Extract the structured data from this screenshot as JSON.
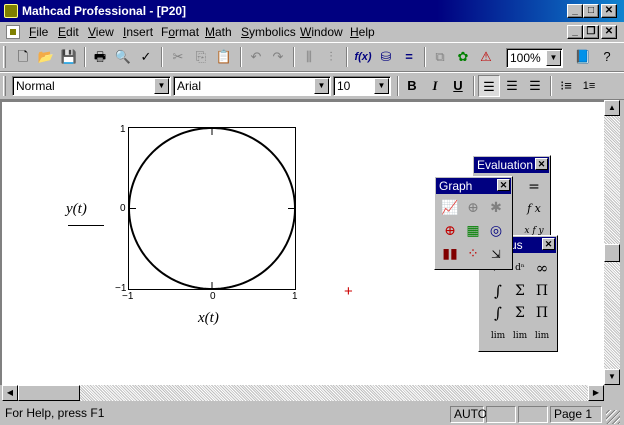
{
  "window": {
    "title": "Mathcad Professional - [P20]",
    "controls": {
      "minimize": "_",
      "maximize": "□",
      "close": "✕"
    }
  },
  "doc_controls": {
    "minimize": "_",
    "restore": "❐",
    "close": "✕"
  },
  "menu": [
    {
      "pre": "",
      "u": "F",
      "post": "ile"
    },
    {
      "pre": "",
      "u": "E",
      "post": "dit"
    },
    {
      "pre": "",
      "u": "V",
      "post": "iew"
    },
    {
      "pre": "",
      "u": "I",
      "post": "nsert"
    },
    {
      "pre": "F",
      "u": "o",
      "post": "rmat"
    },
    {
      "pre": "",
      "u": "M",
      "post": "ath"
    },
    {
      "pre": "",
      "u": "S",
      "post": "ymbolics"
    },
    {
      "pre": "",
      "u": "W",
      "post": "indow"
    },
    {
      "pre": "",
      "u": "H",
      "post": "elp"
    }
  ],
  "toolbar": {
    "zoom": "100%",
    "icons": [
      "new-icon",
      "open-icon",
      "save-icon",
      "print-icon",
      "print-preview-icon",
      "spell-check-icon",
      "cut-icon",
      "copy-icon",
      "paste-icon",
      "undo-icon",
      "redo-icon",
      "align-icon",
      "align-down-icon",
      "insert-function-icon",
      "insert-unit-icon",
      "calculate-icon",
      "insert-component-icon",
      "resources-icon",
      "help-icon"
    ],
    "function_label": "f(x)"
  },
  "format_bar": {
    "style": "Normal",
    "font": "Arial",
    "size": "10",
    "bold": "B",
    "italic": "I",
    "underline": "U"
  },
  "plot": {
    "y_label": "y(t)",
    "x_label": "x(t)",
    "y_max": "1",
    "y_mid": "0",
    "y_min": "−1",
    "x_min": "−1",
    "x_mid": "0",
    "x_max": "1",
    "trace_color": "#000000"
  },
  "chart_data": {
    "type": "line",
    "title": "",
    "xlabel": "x(t)",
    "ylabel": "y(t)",
    "xlim": [
      -1,
      1
    ],
    "ylim": [
      -1,
      1
    ],
    "grid": false,
    "series": [
      {
        "x": [
          1,
          0.866,
          0.5,
          0,
          -0.5,
          -0.866,
          -1,
          -0.866,
          -0.5,
          0,
          0.5,
          0.866,
          1
        ],
        "y": [
          0,
          0.5,
          0.866,
          1,
          0.866,
          0.5,
          0,
          -0.5,
          -0.866,
          -1,
          -0.866,
          -0.5,
          0
        ]
      }
    ]
  },
  "cursor": {
    "symbol": "+",
    "color": "#cc0000"
  },
  "palettes": {
    "evaluation": {
      "title": "Evaluation",
      "buttons": [
        "=",
        "f x",
        "x f y"
      ]
    },
    "graph": {
      "title": "Graph"
    },
    "calculus": {
      "title": "us",
      "buttons": [
        "∞",
        "∫",
        "Σ",
        "Π",
        "∫",
        "Σ",
        "Π",
        "lim",
        "lim",
        "lim"
      ]
    }
  },
  "status": {
    "help": "For Help, press F1",
    "mode": "AUTO",
    "page": "Page 1"
  }
}
